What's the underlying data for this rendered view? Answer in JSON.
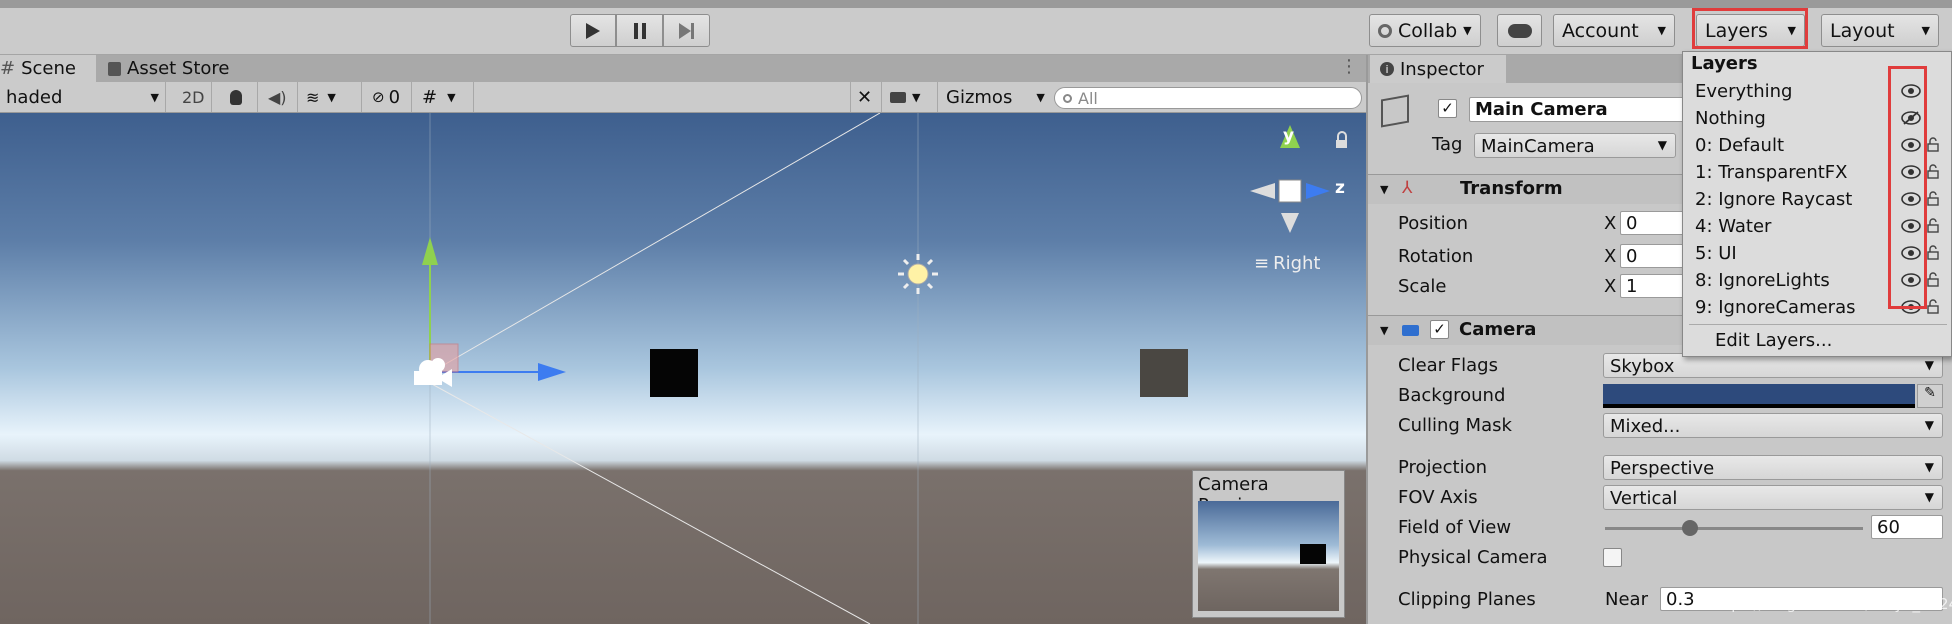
{
  "toolbar": {
    "collab": "Collab",
    "account": "Account",
    "layers": "Layers",
    "layout": "Layout"
  },
  "tabs": {
    "scene": "Scene",
    "asset_store": "Asset Store",
    "inspector": "Inspector"
  },
  "scene_bar": {
    "shading": "haded",
    "two_d": "2D",
    "hidden_count": "0",
    "gizmos": "Gizmos",
    "search_placeholder": "All"
  },
  "gizmo": {
    "y": "y",
    "z": "z",
    "view": "Right"
  },
  "camera_preview": {
    "title": "Camera Preview"
  },
  "inspector": {
    "object_name": "Main Camera",
    "tag_label": "Tag",
    "tag_value": "MainCamera",
    "transform": {
      "title": "Transform",
      "position": "Position",
      "rotation": "Rotation",
      "scale": "Scale",
      "x_label": "X",
      "pos_x": "0",
      "rot_x": "0",
      "scale_x": "1"
    },
    "camera": {
      "title": "Camera",
      "clear_flags": "Clear Flags",
      "clear_flags_value": "Skybox",
      "background": "Background",
      "background_color": "#2d4a7c",
      "culling_mask": "Culling Mask",
      "culling_mask_value": "Mixed...",
      "projection": "Projection",
      "projection_value": "Perspective",
      "fov_axis": "FOV Axis",
      "fov_axis_value": "Vertical",
      "field_of_view": "Field of View",
      "fov_value": "60",
      "fov_fraction": 0.33,
      "physical_camera": "Physical Camera",
      "clipping_planes": "Clipping Planes",
      "near_label": "Near",
      "near_value": "0.3"
    }
  },
  "layers_menu": {
    "title": "Layers",
    "items": [
      {
        "label": "Everything",
        "eye": "visible",
        "lock": false
      },
      {
        "label": "Nothing",
        "eye": "hidden",
        "lock": false
      },
      {
        "label": "0: Default",
        "eye": "visible",
        "lock": true
      },
      {
        "label": "1: TransparentFX",
        "eye": "visible",
        "lock": true
      },
      {
        "label": "2: Ignore Raycast",
        "eye": "visible",
        "lock": true
      },
      {
        "label": "4: Water",
        "eye": "visible",
        "lock": true
      },
      {
        "label": "5: UI",
        "eye": "visible",
        "lock": true
      },
      {
        "label": "8: IgnoreLights",
        "eye": "visible",
        "lock": true
      },
      {
        "label": "9: IgnoreCameras",
        "eye": "visible",
        "lock": true
      }
    ],
    "edit": "Edit Layers..."
  },
  "watermark": "https://blog.csdn.net/Tokyo_2024",
  "colors": {
    "highlight": "#e03c3c",
    "gizmo_y": "#8fd14f",
    "gizmo_z": "#3d7cf0",
    "sky_top": "#3e5f8e",
    "horizon": "#e8f3fb",
    "ground": "#6f6560"
  }
}
